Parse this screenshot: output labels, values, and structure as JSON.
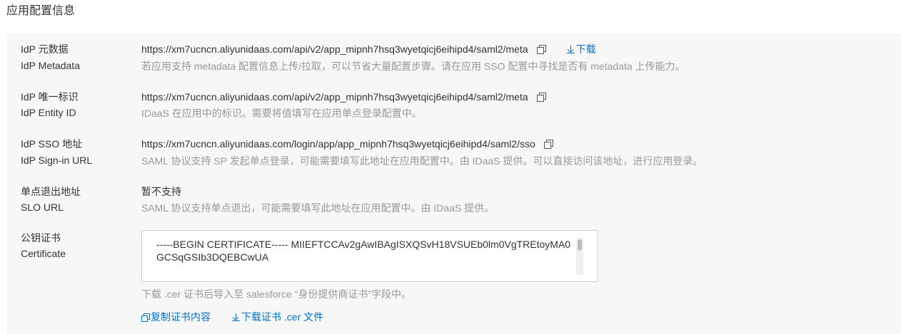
{
  "section_title": "应用配置信息",
  "rows": [
    {
      "label_cn": "IdP 元数据",
      "label_en": "IdP Metadata",
      "value": "https://xm7ucncn.aliyunidaas.com/api/v2/app_mipnh7hsq3wyetqicj6eihipd4/saml2/meta",
      "download_label": "下载",
      "desc": "若应用支持 metadata 配置信息上传/拉取，可以节省大量配置步骤。请在应用 SSO 配置中寻找是否有 metadata 上传能力。"
    },
    {
      "label_cn": "IdP 唯一标识",
      "label_en": "IdP Entity ID",
      "value": "https://xm7ucncn.aliyunidaas.com/api/v2/app_mipnh7hsq3wyetqicj6eihipd4/saml2/meta",
      "desc": "IDaaS 在应用中的标识。需要将值填写在应用单点登录配置中。"
    },
    {
      "label_cn": "IdP SSO 地址",
      "label_en": "IdP Sign-in URL",
      "value": "https://xm7ucncn.aliyunidaas.com/login/app/app_mipnh7hsq3wyetqicj6eihipd4/saml2/sso",
      "desc": "SAML 协议支持 SP 发起单点登录，可能需要填写此地址在应用配置中。由 IDaaS 提供。可以直接访问该地址，进行应用登录。"
    },
    {
      "label_cn": "单点退出地址",
      "label_en": "SLO URL",
      "value": "暂不支持",
      "desc": "SAML 协议支持单点退出，可能需要填写此地址在应用配置中。由 IDaaS 提供。"
    },
    {
      "label_cn": "公钥证书",
      "label_en": "Certificate",
      "cert_text": "-----BEGIN CERTIFICATE----- MIIEFTCCAv2gAwIBAgISXQSvH18VSUEb0lm0VgTREtoyMA0GCSqGSIb3DQEBCwUA",
      "desc": "下载 .cer 证书后导入至 salesforce “身份提供商证书”字段中。",
      "copy_action": "复制证书内容",
      "download_action": "下载证书 .cer 文件"
    }
  ],
  "colors": {
    "link": "#0070cc",
    "panel_bg": "#f7f7f7",
    "muted_text": "#999999"
  }
}
